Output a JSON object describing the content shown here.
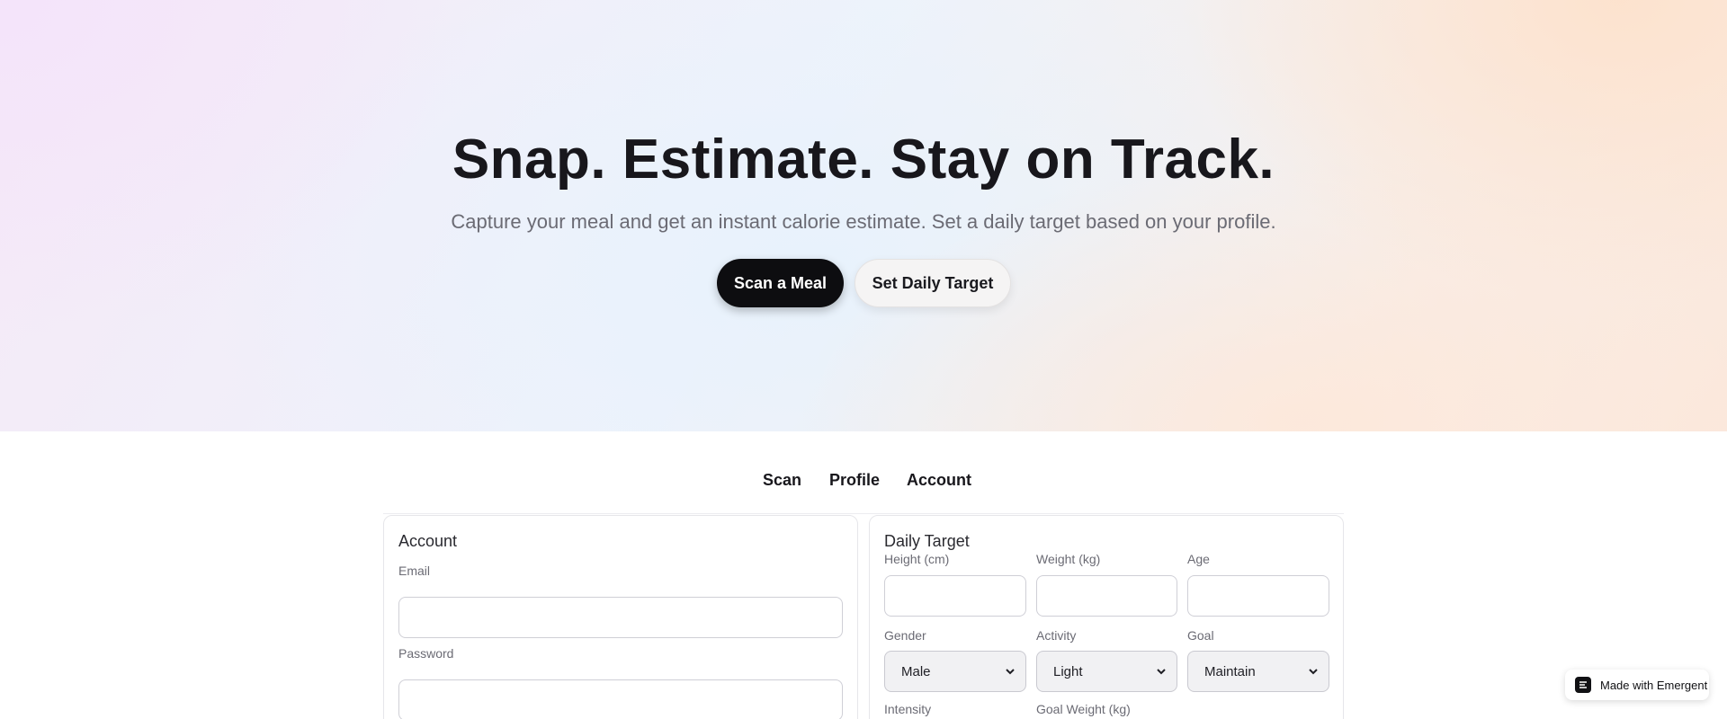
{
  "hero": {
    "title": "Snap. Estimate. Stay on Track.",
    "subtitle": "Capture your meal and get an instant calorie estimate. Set a daily target based on your profile.",
    "primary_button": "Scan a Meal",
    "secondary_button": "Set Daily Target"
  },
  "tabs": [
    {
      "label": "Scan"
    },
    {
      "label": "Profile"
    },
    {
      "label": "Account"
    }
  ],
  "account": {
    "title": "Account",
    "email_label": "Email",
    "email_value": "",
    "password_label": "Password",
    "password_value": ""
  },
  "daily_target": {
    "title": "Daily Target",
    "height_label": "Height (cm)",
    "weight_label": "Weight (kg)",
    "age_label": "Age",
    "gender_label": "Gender",
    "gender_value": "Male",
    "activity_label": "Activity",
    "activity_value": "Light",
    "goal_label": "Goal",
    "goal_value": "Maintain",
    "intensity_label": "Intensity",
    "goal_weight_label": "Goal Weight (kg)"
  },
  "badge": {
    "label": "Made with Emergent"
  },
  "icons": {
    "select_chevron": "chevron-down-icon",
    "badge_logo": "emergent-logo-icon"
  },
  "colors": {
    "primary_button_bg": "#0d0d10",
    "secondary_button_bg": "#f5f4f4",
    "text": "#18171c",
    "muted_text": "#6b6b74"
  }
}
